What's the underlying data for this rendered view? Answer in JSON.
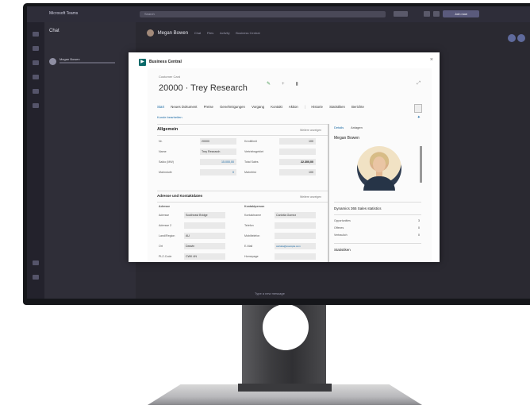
{
  "teams": {
    "app_name": "Microsoft Teams",
    "search_placeholder": "Search",
    "chat_header": "Chat",
    "chat_item_name": "Megan Bowen",
    "contact_name": "Megan Bowen",
    "chat_tabs": [
      "Chat",
      "Files",
      "Activity",
      "Business Central"
    ],
    "join_label": "Join now",
    "compose_placeholder": "Type a new message"
  },
  "dialog": {
    "title": "Business Central",
    "logo_glyph": "▶",
    "close_glyph": "×",
    "breadcrumb": "Customer Card",
    "record_title": "20000 · Trey Research",
    "menu": [
      "Start",
      "Neues Dokument",
      "Preise",
      "Genehmigungen",
      "Vorgang",
      "Kontakt",
      "Aktion",
      "Mehr Optionen",
      "Historie",
      "Statistiken",
      "Berichte",
      "Weniger Optionen"
    ],
    "action": "Kunde bearbeiten",
    "general": {
      "title": "Allgemein",
      "link": "Weitere anzeigen",
      "left": [
        {
          "label": "Nr.",
          "value": "20000"
        },
        {
          "label": "Name",
          "value": "Trey Research"
        },
        {
          "label": "Saldo (MW)",
          "value": "15.000,00"
        },
        {
          "label": "Mahnstufe",
          "value": "0"
        }
      ],
      "right": [
        {
          "label": "Kreditlimit",
          "value": "100"
        },
        {
          "label": "Vertriebsgebiet",
          "value": ""
        },
        {
          "label": "Total Sales",
          "value": "22.300,00"
        },
        {
          "label": "Mahnfrist",
          "value": "100"
        }
      ]
    },
    "address": {
      "title": "Adresse und Kontaktdaten",
      "link": "Weitere anzeigen",
      "col_left": "Adresse",
      "col_right": "Kontaktperson",
      "left": [
        {
          "label": "Adresse",
          "value": "Southeast Bridge"
        },
        {
          "label": "Adresse 2",
          "value": ""
        },
        {
          "label": "Land/Region",
          "value": "AU"
        },
        {
          "label": "Ort",
          "value": "Darwin"
        },
        {
          "label": "PLZ-Code",
          "value": "CWK 4N"
        }
      ],
      "right": [
        {
          "label": "Kontaktname",
          "value": "Carlotta Gomez"
        },
        {
          "label": "Telefon",
          "value": ""
        },
        {
          "label": "Mobiltelefon",
          "value": ""
        },
        {
          "label": "E-Mail",
          "value": "carlotta@example.com"
        },
        {
          "label": "Homepage",
          "value": ""
        }
      ]
    },
    "factbox": {
      "tabs": [
        "Details",
        "Anlagen"
      ],
      "heading": "Megan Bowen",
      "stats_title": "Dynamics 365 Sales statistics",
      "stats_rows": [
        {
          "label": "Opportunities",
          "value": "3"
        },
        {
          "label": "Offenes",
          "value": "0"
        },
        {
          "label": "Vertraulich",
          "value": "0"
        }
      ],
      "more_title": "Statistiken"
    }
  }
}
